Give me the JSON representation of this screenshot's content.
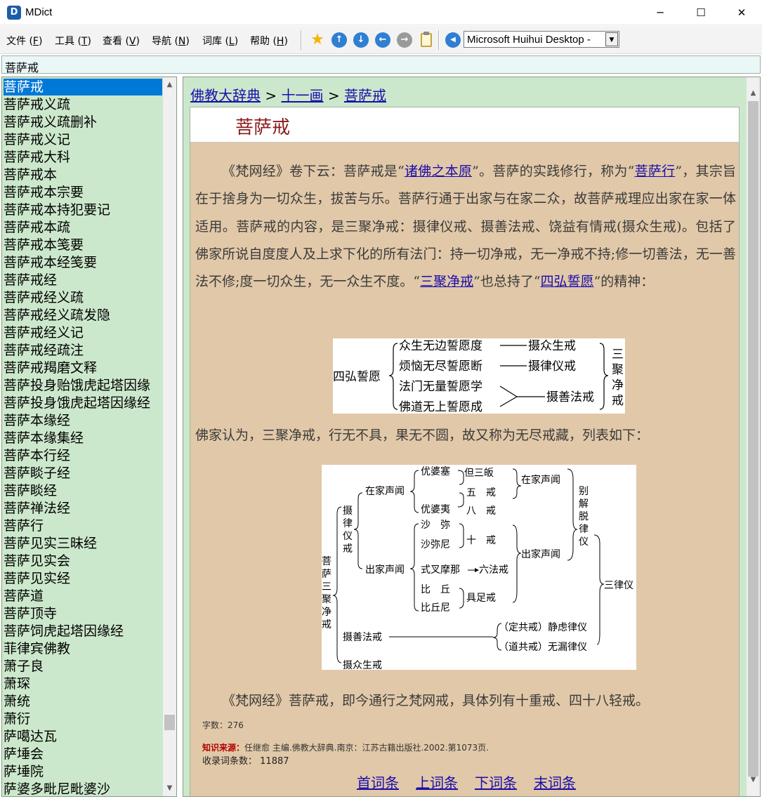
{
  "window": {
    "title": "MDict",
    "icon": "mdict-app-icon",
    "controls": {
      "minimize": "─",
      "maximize": "☐",
      "close": "✕"
    }
  },
  "menubar": {
    "items": [
      {
        "label": "文件 (",
        "acc": "F",
        "end": ")"
      },
      {
        "label": "工具 (",
        "acc": "T",
        "end": ")"
      },
      {
        "label": "查看 (",
        "acc": "V",
        "end": ")"
      },
      {
        "label": "导航 (",
        "acc": "N",
        "end": ")"
      },
      {
        "label": "词库 (",
        "acc": "L",
        "end": ")"
      },
      {
        "label": "帮助 (",
        "acc": "H",
        "end": ")"
      }
    ]
  },
  "toolbar": {
    "buttons": [
      {
        "icon": "favorite-star-icon",
        "glyph": "★",
        "color": "#f5b400"
      },
      {
        "icon": "arrow-up-icon",
        "glyph": "↑",
        "color": "#2f7fd3"
      },
      {
        "icon": "arrow-down-icon",
        "glyph": "↓",
        "color": "#2f7fd3"
      },
      {
        "icon": "back-arrow-icon",
        "glyph": "←",
        "color": "#2f7fd3"
      },
      {
        "icon": "forward-arrow-icon",
        "glyph": "→",
        "color": "#9a9a9a"
      },
      {
        "icon": "clipboard-icon",
        "glyph": "📋",
        "color": "#d8b24a"
      },
      {
        "icon": "speaker-icon",
        "glyph": "◀",
        "color": "#2f7fd3"
      }
    ],
    "dictionary": "Microsoft Huihui Desktop - "
  },
  "search": {
    "value": "菩萨戒"
  },
  "wordlist": {
    "items": [
      "菩萨戒",
      "菩萨戒义疏",
      "菩萨戒义疏删补",
      "菩萨戒义记",
      "菩萨戒大科",
      "菩萨戒本",
      "菩萨戒本宗要",
      "菩萨戒本持犯要记",
      "菩萨戒本疏",
      "菩萨戒本笺要",
      "菩萨戒本经笺要",
      "菩萨戒经",
      "菩萨戒经义疏",
      "菩萨戒经义疏发隐",
      "菩萨戒经义记",
      "菩萨戒经疏注",
      "菩萨戒羯磨文释",
      "菩萨投身贻饿虎起塔因缘",
      "菩萨投身饿虎起塔因缘经",
      "菩萨本缘经",
      "菩萨本缘集经",
      "菩萨本行经",
      "菩萨睒子经",
      "菩萨睒经",
      "菩萨禅法经",
      "菩萨行",
      "菩萨见实三昧经",
      "菩萨见实会",
      "菩萨见实经",
      "菩萨道",
      "菩萨顶寺",
      "菩萨饲虎起塔因缘经",
      "菲律宾佛教",
      "萧子良",
      "萧琛",
      "萧统",
      "萧衍",
      "萨噶达瓦",
      "萨埵会",
      "萨埵院",
      "萨婆多毗尼毗婆沙"
    ],
    "selected_index": 0,
    "selected_color": "#0078d7",
    "background_color": "#cce8cc"
  },
  "content": {
    "breadcrumb": {
      "root": "佛教大辞典",
      "sep1": " > ",
      "section": "十一画",
      "sep2": " > ",
      "current": "菩萨戒"
    },
    "headword": "菩萨戒",
    "headword_color": "#8b1a1a",
    "para1": {
      "t1": "《梵网经》卷下云：菩萨戒是“",
      "link1": "诸佛之本原",
      "t2": "”。菩萨的实践修行，称为“",
      "link2": "菩萨行",
      "t3": "”，其宗旨在于捨身为一切众生，拔苦与乐。菩萨行通于出家与在家二众，故菩萨戒理应出家在家一体适用。菩萨戒的内容，是三聚净戒：摄律仪戒、摄善法戒、饶益有情戒(摄众生戒)。包括了佛家所说自度度人及上求下化的所有法门：持一切净戒，无一净戒不持;修一切善法，无一善法不修;度一切众生，无一众生不度。“",
      "link3": "三聚净戒",
      "t4": "”也总持了“",
      "link4": "四弘誓愿",
      "t5": "”的精神："
    },
    "figure1": {
      "left": "四弘誓愿",
      "vows": [
        "众生无边誓愿度",
        "烦恼无尽誓愿断",
        "法门无量誓愿学",
        "佛道无上誓愿成"
      ],
      "precepts": [
        "摄众生戒",
        "摄律仪戒",
        "摄善法戒"
      ],
      "right": [
        "三",
        "聚",
        "净",
        "戒"
      ]
    },
    "para2": "佛家认为，三聚净戒，行无不具，果无不圆，故又称为无尽戒藏，列表如下：",
    "figure2": {
      "root": [
        "菩",
        "萨",
        "三",
        "聚",
        "净",
        "戒"
      ],
      "sheyi": [
        "摄",
        "律",
        "仪",
        "戒"
      ],
      "zaijia": "在家声闻",
      "chujia": "出家声闻",
      "youposai": "优婆塞",
      "youpoyi": "优婆夷",
      "sanjie": "但三皈",
      "wujie": "五　戒",
      "bajie": "八　戒",
      "shami": "沙　弥",
      "shamini": "沙弥尼",
      "shijie": "十　戒",
      "shichamona": "式叉摩那",
      "liufa": "六法戒",
      "biqiu": "比　丘",
      "biqiuni": "比丘尼",
      "juzu": "具足戒",
      "zaijia_r": "在家声闻",
      "chujia_r": "出家声闻",
      "bieje": [
        "别",
        "解",
        "脱",
        "律",
        "仪"
      ],
      "sanlvyi": "三律仪",
      "shanfa": "摄善法戒",
      "dinggong": "（定共戒）静虑律仪",
      "daogong": "（道共戒）无漏律仪",
      "zhongsheng": "摄众生戒"
    },
    "para3": "《梵网经》菩萨戒，即今通行之梵网戒，具体列有十重戒、四十八轻戒。",
    "char_count": "字数：276",
    "source_label": "知识来源：",
    "source_text": "任继愈 主编.佛教大辞典.南京：江苏古籍出版社.2002.第1073页.",
    "count_label": "收录词条数：",
    "count_value": "11887",
    "nav": {
      "first": "首词条",
      "prev": "上词条",
      "next": "下词条",
      "last": "末词条"
    }
  }
}
